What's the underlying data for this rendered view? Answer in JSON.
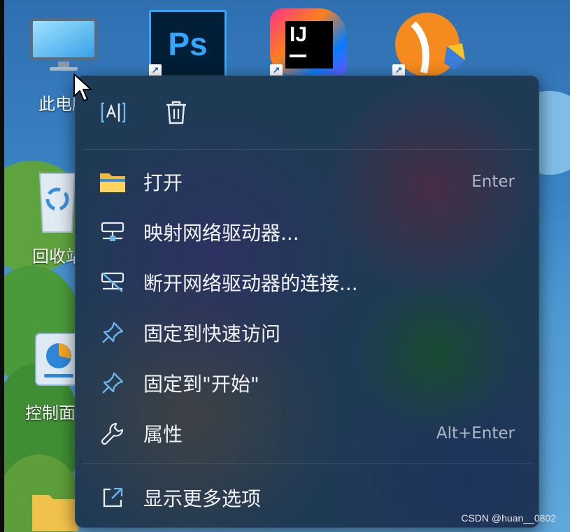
{
  "desktop": {
    "icons": [
      {
        "label": "此电脑"
      },
      {
        "label": "回收站"
      },
      {
        "label": "控制面板"
      }
    ],
    "app_tiles": [
      {
        "name": "photoshop",
        "text": "Ps"
      },
      {
        "name": "intellij",
        "text": "IJ"
      }
    ]
  },
  "context_menu": {
    "toolbar": [
      {
        "name": "rename-icon"
      },
      {
        "name": "delete-icon"
      }
    ],
    "items": [
      {
        "label": "打开",
        "shortcut": "Enter",
        "icon": "folder-icon"
      },
      {
        "label": "映射网络驱动器...",
        "shortcut": "",
        "icon": "network-drive-icon"
      },
      {
        "label": "断开网络驱动器的连接...",
        "shortcut": "",
        "icon": "disconnect-drive-icon"
      },
      {
        "label": "固定到快速访问",
        "shortcut": "",
        "icon": "pin-icon"
      },
      {
        "label": "固定到\"开始\"",
        "shortcut": "",
        "icon": "pin-icon"
      },
      {
        "label": "属性",
        "shortcut": "Alt+Enter",
        "icon": "wrench-icon"
      },
      {
        "label": "显示更多选项",
        "shortcut": "",
        "icon": "share-icon"
      }
    ]
  },
  "watermark": "CSDN @huan__0802",
  "colors": {
    "menu_bg": "#1f3a55",
    "accent_icon": "#6ab7f0",
    "text": "#f2f4f7"
  }
}
